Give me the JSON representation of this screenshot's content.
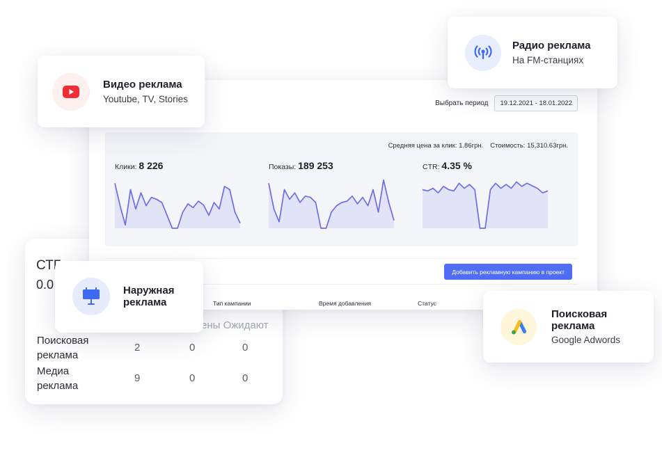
{
  "dashboard": {
    "period_label": "Выбрать период",
    "period_value": "19.12.2021 - 18.01.2022",
    "avg_price": "Средняя цена за клик: 1.86грн.",
    "cost": "Стоимость: 15,310.63грн.",
    "metrics": [
      {
        "label": "Клики:",
        "value": "8 226"
      },
      {
        "label": "Показы:",
        "value": "189 253"
      },
      {
        "label": "CTR:",
        "value": "4.35 %"
      }
    ],
    "add_button": "Добавить рекламную кампанию в проект",
    "columns": [
      "Тип кампании",
      "Время добавления",
      "Статус"
    ]
  },
  "back_table": {
    "ctr_label": "СТГ",
    "ctr_value": "0.0",
    "header": "ены Ожидают",
    "rows": [
      {
        "name": "Поисковая реклама",
        "values": [
          "2",
          "0",
          "0"
        ]
      },
      {
        "name": "Медиа реклама",
        "values": [
          "9",
          "0",
          "0"
        ]
      }
    ]
  },
  "badges": {
    "video": {
      "title": "Видео реклама",
      "subtitle": "Youtube, TV, Stories"
    },
    "radio": {
      "title": "Радио реклама",
      "subtitle": "На FM-станциях"
    },
    "outdoor": {
      "title": "Наружная реклама"
    },
    "search": {
      "title": "Поисковая реклама",
      "subtitle": "Google Adwords"
    }
  },
  "colors": {
    "accent": "#4f6df5",
    "chart_line": "#6b6ee8",
    "chart_fill": "#e3e3f7",
    "youtube": "#f02d36",
    "video_bg": "#fdf0ee",
    "radio_bg": "#e8eefd",
    "outdoor_bg": "#e6ecfc",
    "adwords_bg": "#fff6dc"
  },
  "icons": {
    "video": "youtube-icon",
    "radio": "radio-broadcast-icon",
    "outdoor": "billboard-icon",
    "search": "google-ads-icon"
  },
  "chart_data": [
    {
      "type": "area",
      "title": "Клики",
      "values": [
        70,
        35,
        5,
        60,
        30,
        55,
        35,
        48,
        45,
        40,
        20,
        0,
        0,
        25,
        38,
        32,
        42,
        36,
        20,
        40,
        30,
        65,
        60,
        25,
        8
      ]
    },
    {
      "type": "area",
      "title": "Показы",
      "values": [
        70,
        30,
        10,
        60,
        45,
        55,
        40,
        50,
        48,
        40,
        0,
        0,
        25,
        35,
        40,
        42,
        50,
        38,
        48,
        35,
        60,
        25,
        75,
        40,
        12
      ]
    },
    {
      "type": "area",
      "title": "CTR",
      "values": [
        60,
        58,
        62,
        55,
        65,
        60,
        58,
        70,
        62,
        68,
        60,
        0,
        0,
        60,
        70,
        62,
        68,
        62,
        72,
        65,
        70,
        66,
        62,
        55,
        58
      ]
    }
  ]
}
